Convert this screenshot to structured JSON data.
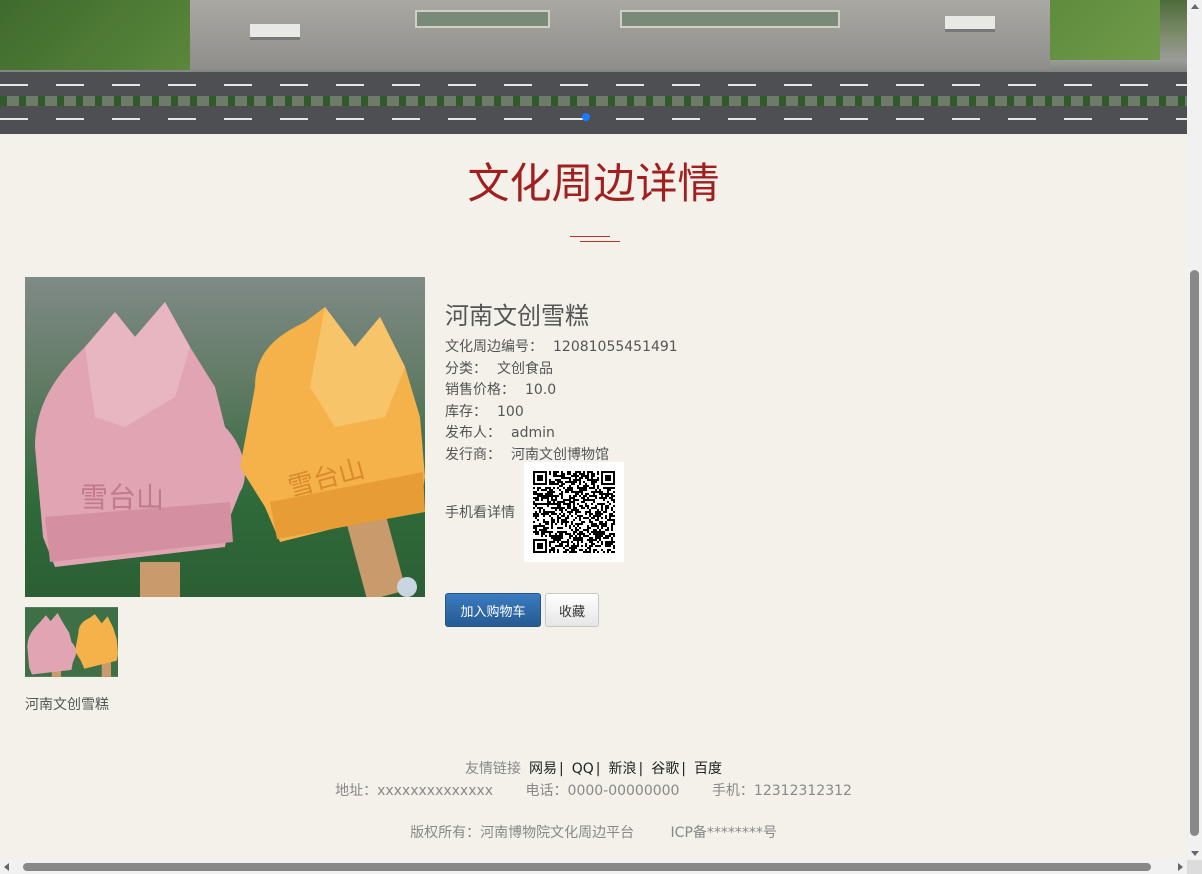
{
  "page": {
    "title": "文化周边详情"
  },
  "product": {
    "name": "河南文创雪糕",
    "fields": [
      {
        "label": "文化周边编号：",
        "value": "12081055451491"
      },
      {
        "label": "分类：",
        "value": "文创食品"
      },
      {
        "label": "销售价格：",
        "value": "10.0"
      },
      {
        "label": "库存：",
        "value": "100"
      },
      {
        "label": "发布人：",
        "value": "admin"
      },
      {
        "label": "发行商：",
        "value": "河南文创博物馆"
      }
    ],
    "mobile_label": "手机看详情",
    "thumbnail_caption": "河南文创雪糕"
  },
  "actions": {
    "add_to_cart": "加入购物车",
    "favorite": "收藏"
  },
  "footer": {
    "links_label": "友情链接",
    "links": [
      "网易",
      "QQ",
      "新浪",
      "谷歌",
      "百度"
    ],
    "link_separator": "|",
    "address": "地址：xxxxxxxxxxxxxx",
    "phone": "电话：0000-00000000",
    "mobile": "手机：12312312312",
    "copyright": "版权所有：河南博物院文化周边平台",
    "icp": "ICP备********号"
  },
  "colors": {
    "title_red": "#a11f1f",
    "cart_button_blue": "#2f6aa7",
    "background": "#f3f1ea",
    "carousel_active_dot": "#1a7bff"
  }
}
